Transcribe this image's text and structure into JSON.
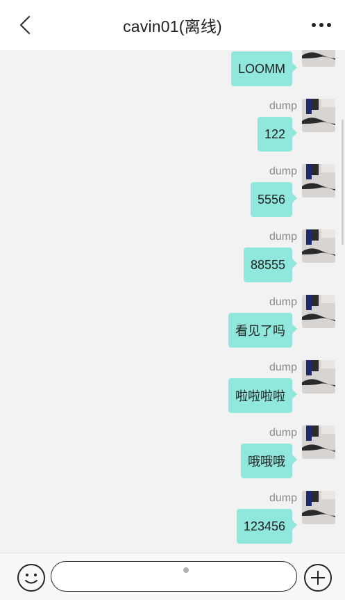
{
  "header": {
    "title": "cavin01(离线)",
    "back_icon": "chevron-left-icon",
    "more_icon": "more-horizontal-icon"
  },
  "messages": [
    {
      "sender": "",
      "text": "LOOMM"
    },
    {
      "sender": "dump",
      "text": "122"
    },
    {
      "sender": "dump",
      "text": "5556"
    },
    {
      "sender": "dump",
      "text": "88555"
    },
    {
      "sender": "dump",
      "text": "看见了吗"
    },
    {
      "sender": "dump",
      "text": "啦啦啦啦"
    },
    {
      "sender": "dump",
      "text": "哦哦哦"
    },
    {
      "sender": "dump",
      "text": "123456"
    }
  ],
  "input_bar": {
    "placeholder": "",
    "emoji_icon": "emoji-icon",
    "plus_icon": "plus-icon"
  },
  "colors": {
    "bubble": "#90e8dc",
    "background": "#f2f2f2",
    "header_bg": "#ffffff"
  }
}
